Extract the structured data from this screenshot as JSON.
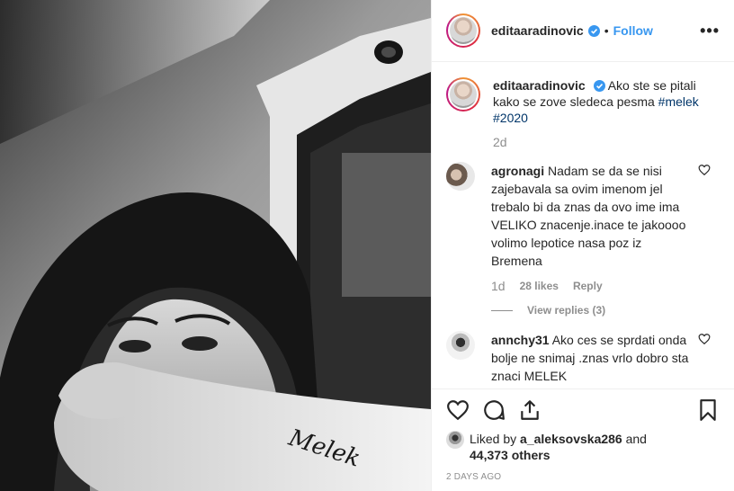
{
  "post": {
    "username": "editaaradinovic",
    "follow_label": "Follow",
    "separator": "•",
    "more_label": "•••",
    "caption_user": "editaaradinovic",
    "caption_text": "Ako ste se pitali kako se zove sledeca pesma",
    "hashtags": [
      "#melek",
      "#2020"
    ],
    "caption_age": "2d",
    "tattoo_text": "Melek"
  },
  "comments": [
    {
      "user": "agronagi",
      "text": "Nadam se da se nisi zajebavala sa ovim imenom jel trebalo bi da znas da ovo ime ima VELIKO znacenje.inace te jakoooo volimo lepotice nasa poz iz Bremena",
      "age": "1d",
      "likes": "28 likes",
      "reply": "Reply",
      "view_replies": "View replies (3)"
    },
    {
      "user": "annchy31",
      "text": "Ako ces se sprdati onda bolje ne snimaj .znas vrlo dobro sta znaci MELEK"
    }
  ],
  "likes": {
    "prefix": "Liked by",
    "user": "a_aleksovska286",
    "and": "and",
    "count": "44,373 others"
  },
  "post_age": "2 DAYS AGO",
  "icons": [
    "verified-badge-icon",
    "heart-icon",
    "comment-icon",
    "share-icon",
    "bookmark-icon",
    "more-options-icon"
  ],
  "colors": {
    "link": "#3897f0",
    "hashtag": "#003569",
    "muted": "#8e8e8e",
    "text": "#262626"
  }
}
